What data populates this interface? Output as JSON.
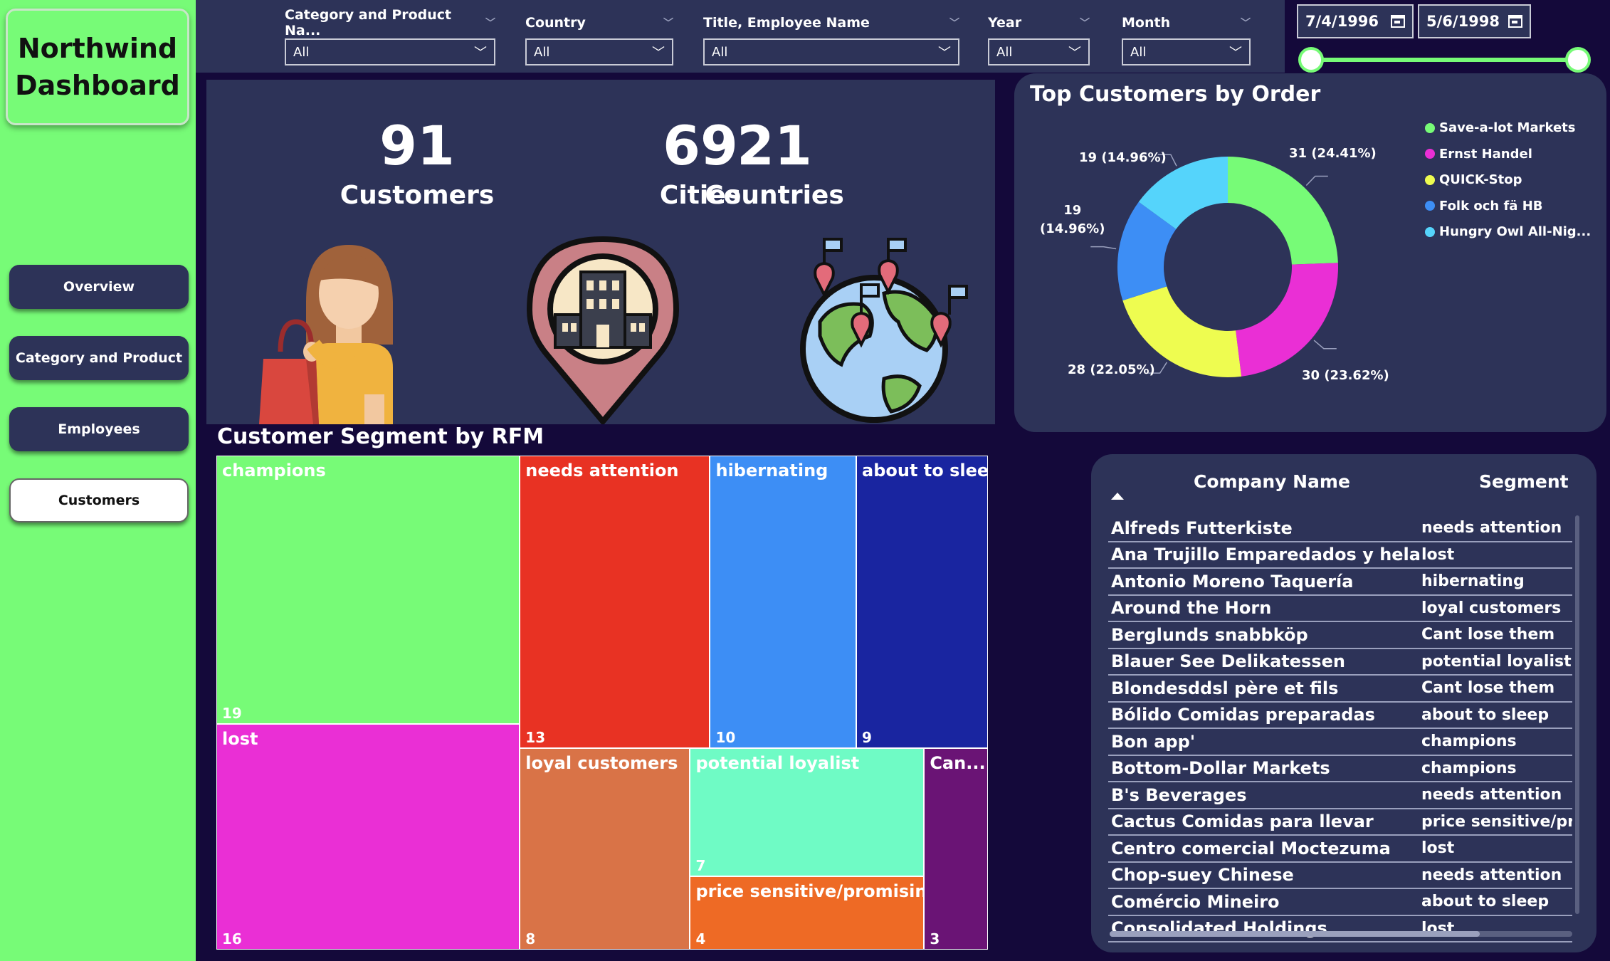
{
  "brand": {
    "title": "Northwind\nDashboard"
  },
  "nav": [
    {
      "label": "Overview"
    },
    {
      "label": "Category and Product"
    },
    {
      "label": "Employees"
    },
    {
      "label": "Customers"
    }
  ],
  "filters": [
    {
      "label": "Category and Product Na...",
      "value": "All"
    },
    {
      "label": "Country",
      "value": "All"
    },
    {
      "label": "Title, Employee Name",
      "value": "All"
    },
    {
      "label": "Year",
      "value": "All"
    },
    {
      "label": "Month",
      "value": "All"
    }
  ],
  "date_range": {
    "start": "7/4/1996",
    "end": "5/6/1998"
  },
  "kpis": [
    {
      "value": "91",
      "label": "Customers",
      "icon": "shopper-icon"
    },
    {
      "value": "69",
      "label": "Cities",
      "icon": "city-pin-icon"
    },
    {
      "value": "21",
      "label": "Countries",
      "icon": "globe-pins-icon"
    }
  ],
  "chart_data": [
    {
      "type": "pie",
      "title": "Top Customers by Order",
      "legend_position": "top-right",
      "labels": [
        "Save-a-lot Markets",
        "Ernst Handel",
        "QUICK-Stop",
        "Folk och fä HB",
        "Hungry Owl All-Nig..."
      ],
      "values": [
        31,
        30,
        28,
        19,
        19
      ],
      "data_labels": [
        "31 (24.41%)",
        "30 (23.62%)",
        "28 (22.05%)",
        "19\n(14.96%)",
        "19 (14.96%)"
      ],
      "colors": [
        "#77fb77",
        "#ea2fd5",
        "#eefc50",
        "#3d8ef5",
        "#55d4fb"
      ]
    },
    {
      "type": "treemap",
      "title": "Customer Segment by RFM",
      "labels": [
        "champions",
        "lost",
        "needs attention",
        "hibernating",
        "about to sleep",
        "loyal customers",
        "potential loyalist",
        "price sensitive/promising",
        "Can..."
      ],
      "values": [
        19,
        16,
        13,
        10,
        9,
        8,
        7,
        4,
        3
      ],
      "colors": [
        "#77fb77",
        "#ea2fd5",
        "#e83223",
        "#3d8ef5",
        "#1925a0",
        "#d97347",
        "#6ffbc5",
        "#ee6a25",
        "#6a1475"
      ]
    }
  ],
  "table": {
    "headers": [
      "Company Name",
      "Segment"
    ],
    "rows": [
      [
        "Alfreds Futterkiste",
        "needs attention"
      ],
      [
        "Ana Trujillo Emparedados y helados",
        "lost"
      ],
      [
        "Antonio Moreno Taquería",
        "hibernating"
      ],
      [
        "Around the Horn",
        "loyal customers"
      ],
      [
        "Berglunds snabbköp",
        "Cant lose them"
      ],
      [
        "Blauer See Delikatessen",
        "potential loyalist"
      ],
      [
        "Blondesddsl père et fils",
        "Cant lose them"
      ],
      [
        "Bólido Comidas preparadas",
        "about to sleep"
      ],
      [
        "Bon app'",
        "champions"
      ],
      [
        "Bottom-Dollar Markets",
        "champions"
      ],
      [
        "B's Beverages",
        "needs attention"
      ],
      [
        "Cactus Comidas para llevar",
        "price sensitive/promising"
      ],
      [
        "Centro comercial Moctezuma",
        "lost"
      ],
      [
        "Chop-suey Chinese",
        "needs attention"
      ],
      [
        "Comércio Mineiro",
        "about to sleep"
      ],
      [
        "Consolidated Holdings",
        "lost"
      ]
    ]
  }
}
